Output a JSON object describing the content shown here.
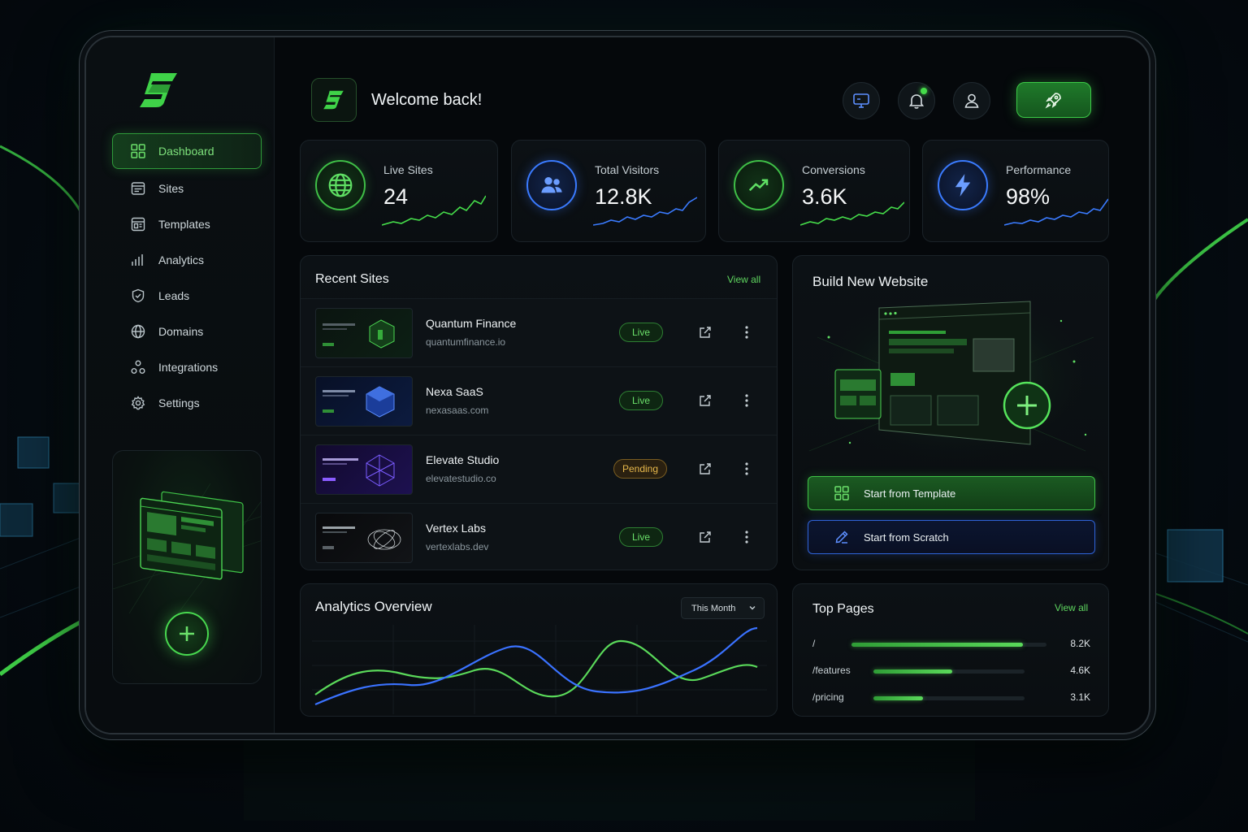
{
  "brand": {
    "logo_icon": "s-logo-icon",
    "accent": "#45dc4a",
    "accent_blue": "#3a7bff"
  },
  "sidebar": {
    "items": [
      {
        "label": "Dashboard",
        "icon": "grid-icon",
        "active": true
      },
      {
        "label": "Sites",
        "icon": "browser-icon"
      },
      {
        "label": "Templates",
        "icon": "template-icon"
      },
      {
        "label": "Analytics",
        "icon": "bar-chart-icon"
      },
      {
        "label": "Leads",
        "icon": "shield-check-icon"
      },
      {
        "label": "Domains",
        "icon": "globe-icon"
      },
      {
        "label": "Integrations",
        "icon": "nodes-icon"
      },
      {
        "label": "Settings",
        "icon": "gear-icon"
      }
    ]
  },
  "header": {
    "welcome": "Welcome back!"
  },
  "stats": [
    {
      "label": "Live Sites",
      "value": "24",
      "icon": "globe-icon",
      "color": "#45dc4a"
    },
    {
      "label": "Total Visitors",
      "value": "12.8K",
      "icon": "users-icon",
      "color": "#3a7bff"
    },
    {
      "label": "Conversions",
      "value": "3.6K",
      "icon": "trend-up-icon",
      "color": "#45dc4a"
    },
    {
      "label": "Performance",
      "value": "98%",
      "icon": "bolt-icon",
      "color": "#3a7bff"
    }
  ],
  "recent_sites": {
    "title": "Recent Sites",
    "view_all": "View all",
    "rows": [
      {
        "name": "Quantum Finance",
        "domain": "quantumfinance.io",
        "status": "Live"
      },
      {
        "name": "Nexa SaaS",
        "domain": "nexasaas.com",
        "status": "Live"
      },
      {
        "name": "Elevate Studio",
        "domain": "elevatestudio.co",
        "status": "Pending"
      },
      {
        "name": "Vertex Labs",
        "domain": "vertexlabs.dev",
        "status": "Live"
      }
    ]
  },
  "build": {
    "title": "Build New Website",
    "template_btn": "Start from Template",
    "scratch_btn": "Start from Scratch"
  },
  "analytics": {
    "title": "Analytics Overview",
    "range": "This Month"
  },
  "top_pages": {
    "title": "Top Pages",
    "view_all": "View all",
    "rows": [
      {
        "path": "/",
        "value": "8.2K",
        "fraction": 0.88
      },
      {
        "path": "/features",
        "value": "4.6K",
        "fraction": 0.52
      },
      {
        "path": "/pricing",
        "value": "3.1K",
        "fraction": 0.33
      }
    ]
  }
}
